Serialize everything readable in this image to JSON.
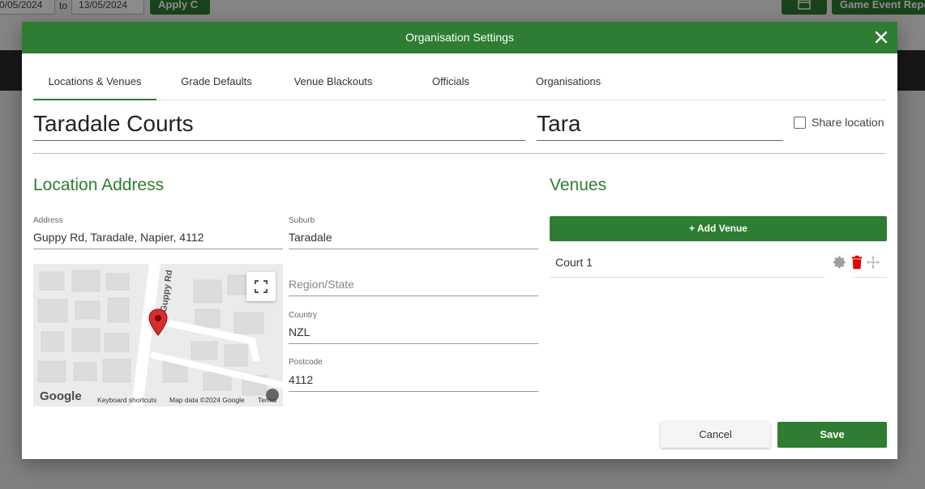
{
  "background": {
    "date_from": "0/05/2024",
    "to_label": "to",
    "date_to": "13/05/2024",
    "apply_label": "Apply C",
    "report_label": "Game Event Repo"
  },
  "modal": {
    "title": "Organisation Settings",
    "close_icon": "close-icon"
  },
  "tabs": [
    {
      "label": "Locations & Venues",
      "active": true
    },
    {
      "label": "Grade Defaults"
    },
    {
      "label": "Venue Blackouts"
    },
    {
      "label": "Officials"
    },
    {
      "label": "Organisations"
    }
  ],
  "location": {
    "name": "Taradale Courts",
    "short_name": "Tara",
    "share_label": "Share location",
    "share_checked": false
  },
  "address_section": {
    "title": "Location Address",
    "address_label": "Address",
    "address_value": "Guppy Rd, Taradale, Napier, 4112",
    "suburb_label": "Suburb",
    "suburb_value": "Taradale",
    "region_placeholder": "Region/State",
    "country_label": "Country",
    "country_value": "NZL",
    "postcode_label": "Postcode",
    "postcode_value": "4112"
  },
  "map": {
    "street_label": "Guppy Rd",
    "google_label": "Google",
    "keyboard_shortcuts": "Keyboard shortcuts",
    "map_data": "Map data ©2024 Google",
    "terms": "Terms"
  },
  "venues": {
    "title": "Venues",
    "add_label": "+ Add Venue",
    "items": [
      {
        "name": "Court 1"
      }
    ]
  },
  "footer": {
    "cancel_label": "Cancel",
    "save_label": "Save"
  },
  "colors": {
    "accent": "#2e7d32",
    "delete": "#e00000"
  }
}
